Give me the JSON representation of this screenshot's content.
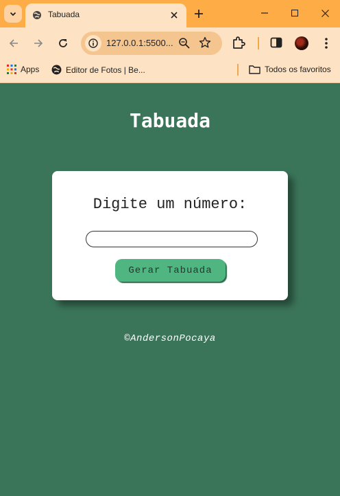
{
  "browser": {
    "tab": {
      "title": "Tabuada"
    },
    "address": {
      "url": "127.0.0.1:5500..."
    },
    "bookmarks": [
      {
        "label": "Apps",
        "icon": "apps-grid-icon"
      },
      {
        "label": "Editor de Fotos | Be...",
        "icon": "globe-icon"
      }
    ],
    "all_bookmarks_label": "Todos os favoritos"
  },
  "page": {
    "title": "Tabuada",
    "prompt_label": "Digite um número:",
    "input": {
      "value": "",
      "placeholder": ""
    },
    "button_label": "Gerar Tabuada",
    "footer": "©AndersonPocaya"
  },
  "colors": {
    "tabstrip": "#fdac46",
    "toolbar": "#fde2c3",
    "page_bg": "#3b7559",
    "button": "#4fb681"
  }
}
